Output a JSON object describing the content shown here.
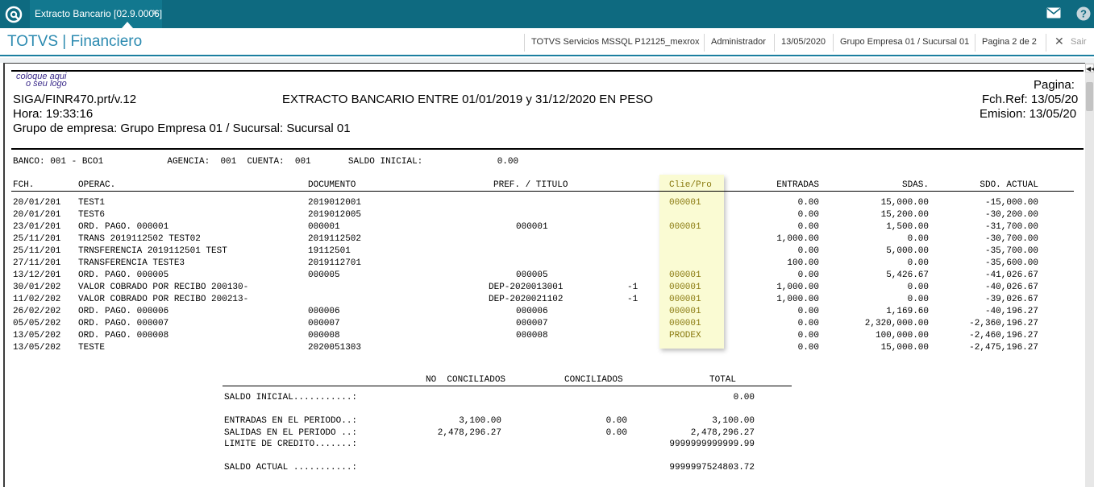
{
  "topbar": {
    "tab_label": "Extracto Bancario [02.9.0006]",
    "tab_close": "×"
  },
  "header": {
    "module_title": "TOTVS | Financiero",
    "environment": "TOTVS Servicios MSSQL P12125_mexrox",
    "user": "Administrador",
    "date": "13/05/2020",
    "company": "Grupo Empresa 01 / Sucursal 01",
    "page": "Pagina 2 de 2",
    "exit_label": "Sair"
  },
  "colors": {
    "topbar": "#0e6a80",
    "title": "#2b8ab0",
    "highlight": "#fafbd3"
  },
  "report": {
    "logo_line1": "coloque aqui",
    "logo_line2": "o seu logo",
    "program": "SIGA/FINR470.prt/v.12",
    "title": "EXTRACTO BANCARIO ENTRE 01/01/2019 y 31/12/2020  EN PESO",
    "pagina_label": "Pagina:",
    "fchref": "Fch.Ref: 13/05/20",
    "hora": "Hora: 19:33:16",
    "emision": "Emision: 13/05/20",
    "grupo": "Grupo de empresa: Grupo Empresa 01 / Sucursal: Sucursal 01",
    "banco_line": "BANCO: 001 - BCO1            AGENCIA:  001  CUENTA:  001       SALDO INICIAL:              0.00",
    "columns": {
      "fch": "FCH.",
      "operac": "OPERAC.",
      "documento": "DOCUMENTO",
      "pref_titulo": "PREF. / TITULO",
      "clie_pro": "Clie/Pro",
      "entradas": "ENTRADAS",
      "sdas": "SDAS.",
      "sdo_actual": "SDO. ACTUAL"
    },
    "rows": [
      {
        "fch": "20/01/201",
        "operac": "TEST1",
        "doc": "2019012001",
        "titulo": "",
        "parc": "",
        "clie": "000001",
        "ent": "0.00",
        "sdas": "15,000.00",
        "saldo": "-15,000.00"
      },
      {
        "fch": "20/01/201",
        "operac": "TEST6",
        "doc": "2019012005",
        "titulo": "",
        "parc": "",
        "clie": "",
        "ent": "0.00",
        "sdas": "15,200.00",
        "saldo": "-30,200.00"
      },
      {
        "fch": "23/01/201",
        "operac": "ORD. PAGO. 000001",
        "doc": "000001",
        "titulo": "000001",
        "parc": "",
        "clie": "000001",
        "ent": "0.00",
        "sdas": "1,500.00",
        "saldo": "-31,700.00"
      },
      {
        "fch": "25/11/201",
        "operac": "TRANS 2019112502 TEST02",
        "doc": "2019112502",
        "titulo": "",
        "parc": "",
        "clie": "",
        "ent": "1,000.00",
        "sdas": "0.00",
        "saldo": "-30,700.00"
      },
      {
        "fch": "25/11/201",
        "operac": "TRNSFERENCIA 2019112501 TEST",
        "doc": "19112501",
        "titulo": "",
        "parc": "",
        "clie": "",
        "ent": "0.00",
        "sdas": "5,000.00",
        "saldo": "-35,700.00"
      },
      {
        "fch": "27/11/201",
        "operac": "TRANSFERENCIA TESTE3",
        "doc": "2019112701",
        "titulo": "",
        "parc": "",
        "clie": "",
        "ent": "100.00",
        "sdas": "0.00",
        "saldo": "-35,600.00"
      },
      {
        "fch": "13/12/201",
        "operac": "ORD. PAGO. 000005",
        "doc": "000005",
        "titulo": "000005",
        "parc": "",
        "clie": "000001",
        "ent": "0.00",
        "sdas": "5,426.67",
        "saldo": "-41,026.67"
      },
      {
        "fch": "30/01/202",
        "operac": "VALOR COBRADO POR RECIBO 200130-",
        "doc": "",
        "titulo": "DEP-2020013001",
        "parc": "-1",
        "clie": "000001",
        "ent": "1,000.00",
        "sdas": "0.00",
        "saldo": "-40,026.67"
      },
      {
        "fch": "11/02/202",
        "operac": "VALOR COBRADO POR RECIBO 200213-",
        "doc": "",
        "titulo": "DEP-2020021102",
        "parc": "-1",
        "clie": "000001",
        "ent": "1,000.00",
        "sdas": "0.00",
        "saldo": "-39,026.67"
      },
      {
        "fch": "26/02/202",
        "operac": "ORD. PAGO. 000006",
        "doc": "000006",
        "titulo": "000006",
        "parc": "",
        "clie": "000001",
        "ent": "0.00",
        "sdas": "1,169.60",
        "saldo": "-40,196.27"
      },
      {
        "fch": "05/05/202",
        "operac": "ORD. PAGO. 000007",
        "doc": "000007",
        "titulo": "000007",
        "parc": "",
        "clie": "000001",
        "ent": "0.00",
        "sdas": "2,320,000.00",
        "saldo": "-2,360,196.27"
      },
      {
        "fch": "13/05/202",
        "operac": "ORD. PAGO. 000008",
        "doc": "000008",
        "titulo": "000008",
        "parc": "",
        "clie": "PRODEX",
        "ent": "0.00",
        "sdas": "100,000.00",
        "saldo": "-2,460,196.27"
      },
      {
        "fch": "13/05/202",
        "operac": "TESTE",
        "doc": "2020051303",
        "titulo": "",
        "parc": "",
        "clie": "",
        "ent": "0.00",
        "sdas": "15,000.00",
        "saldo": "-2,475,196.27"
      }
    ],
    "summary": {
      "headers": {
        "no_conc": "NO  CONCILIADOS",
        "conc": "CONCILIADOS",
        "total": "TOTAL"
      },
      "saldo_inicial": {
        "label": "SALDO INICIAL...........:",
        "no_conc": "",
        "conc": "",
        "total": "0.00"
      },
      "entradas": {
        "label": "ENTRADAS EN EL PERIODO..:",
        "no_conc": "3,100.00",
        "conc": "0.00",
        "total": "3,100.00"
      },
      "salidas": {
        "label": "SALIDAS EN EL PERIODO ..:",
        "no_conc": "2,478,296.27",
        "conc": "0.00",
        "total": "2,478,296.27"
      },
      "limite": {
        "label": "LIMITE DE CREDITO.......:",
        "no_conc": "",
        "conc": "",
        "total": "9999999999999.99"
      },
      "saldo_actual": {
        "label": "SALDO ACTUAL ...........:",
        "no_conc": "",
        "conc": "",
        "total": "9999997524803.72"
      }
    }
  }
}
